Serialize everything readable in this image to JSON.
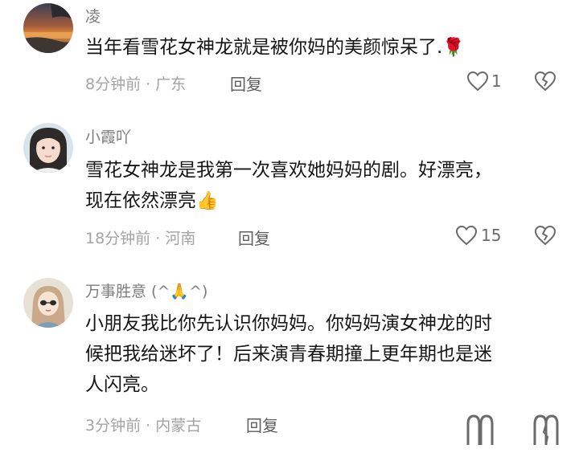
{
  "comments": [
    {
      "username": "凌",
      "lines": [
        "当年看雪花女神龙就是被你妈的美颜惊呆了."
      ],
      "emoji": "🌹",
      "time": "8分钟前",
      "location": "广东",
      "reply_label": "回复",
      "like_count": "1",
      "avatar_theme": "sunset-landscape"
    },
    {
      "username": "小霞吖",
      "lines": [
        "雪花女神龙是我第一次喜欢她妈妈的剧。好漂亮，",
        "现在依然漂亮"
      ],
      "emoji": "👍",
      "time": "18分钟前",
      "location": "河南",
      "reply_label": "回复",
      "like_count": "15",
      "avatar_theme": "girl-portrait"
    },
    {
      "username": "万事胜意",
      "username_suffix_pre": " (^",
      "username_suffix_post": "^)",
      "username_emoji": "🙏",
      "lines": [
        "小朋友我比你先认识你妈妈。你妈妈演女神龙的时",
        "候把我给迷坏了！后来演青春期撞上更年期也是迷",
        "人闪亮。"
      ],
      "emoji": "",
      "time": "3分钟前",
      "location": "内蒙古",
      "reply_label": "回复",
      "like_count": "",
      "avatar_theme": "cartoon-girl"
    }
  ],
  "meta_separator": " · ",
  "icons": {
    "like": "heart-outline-icon",
    "dislike": "broken-heart-icon"
  }
}
